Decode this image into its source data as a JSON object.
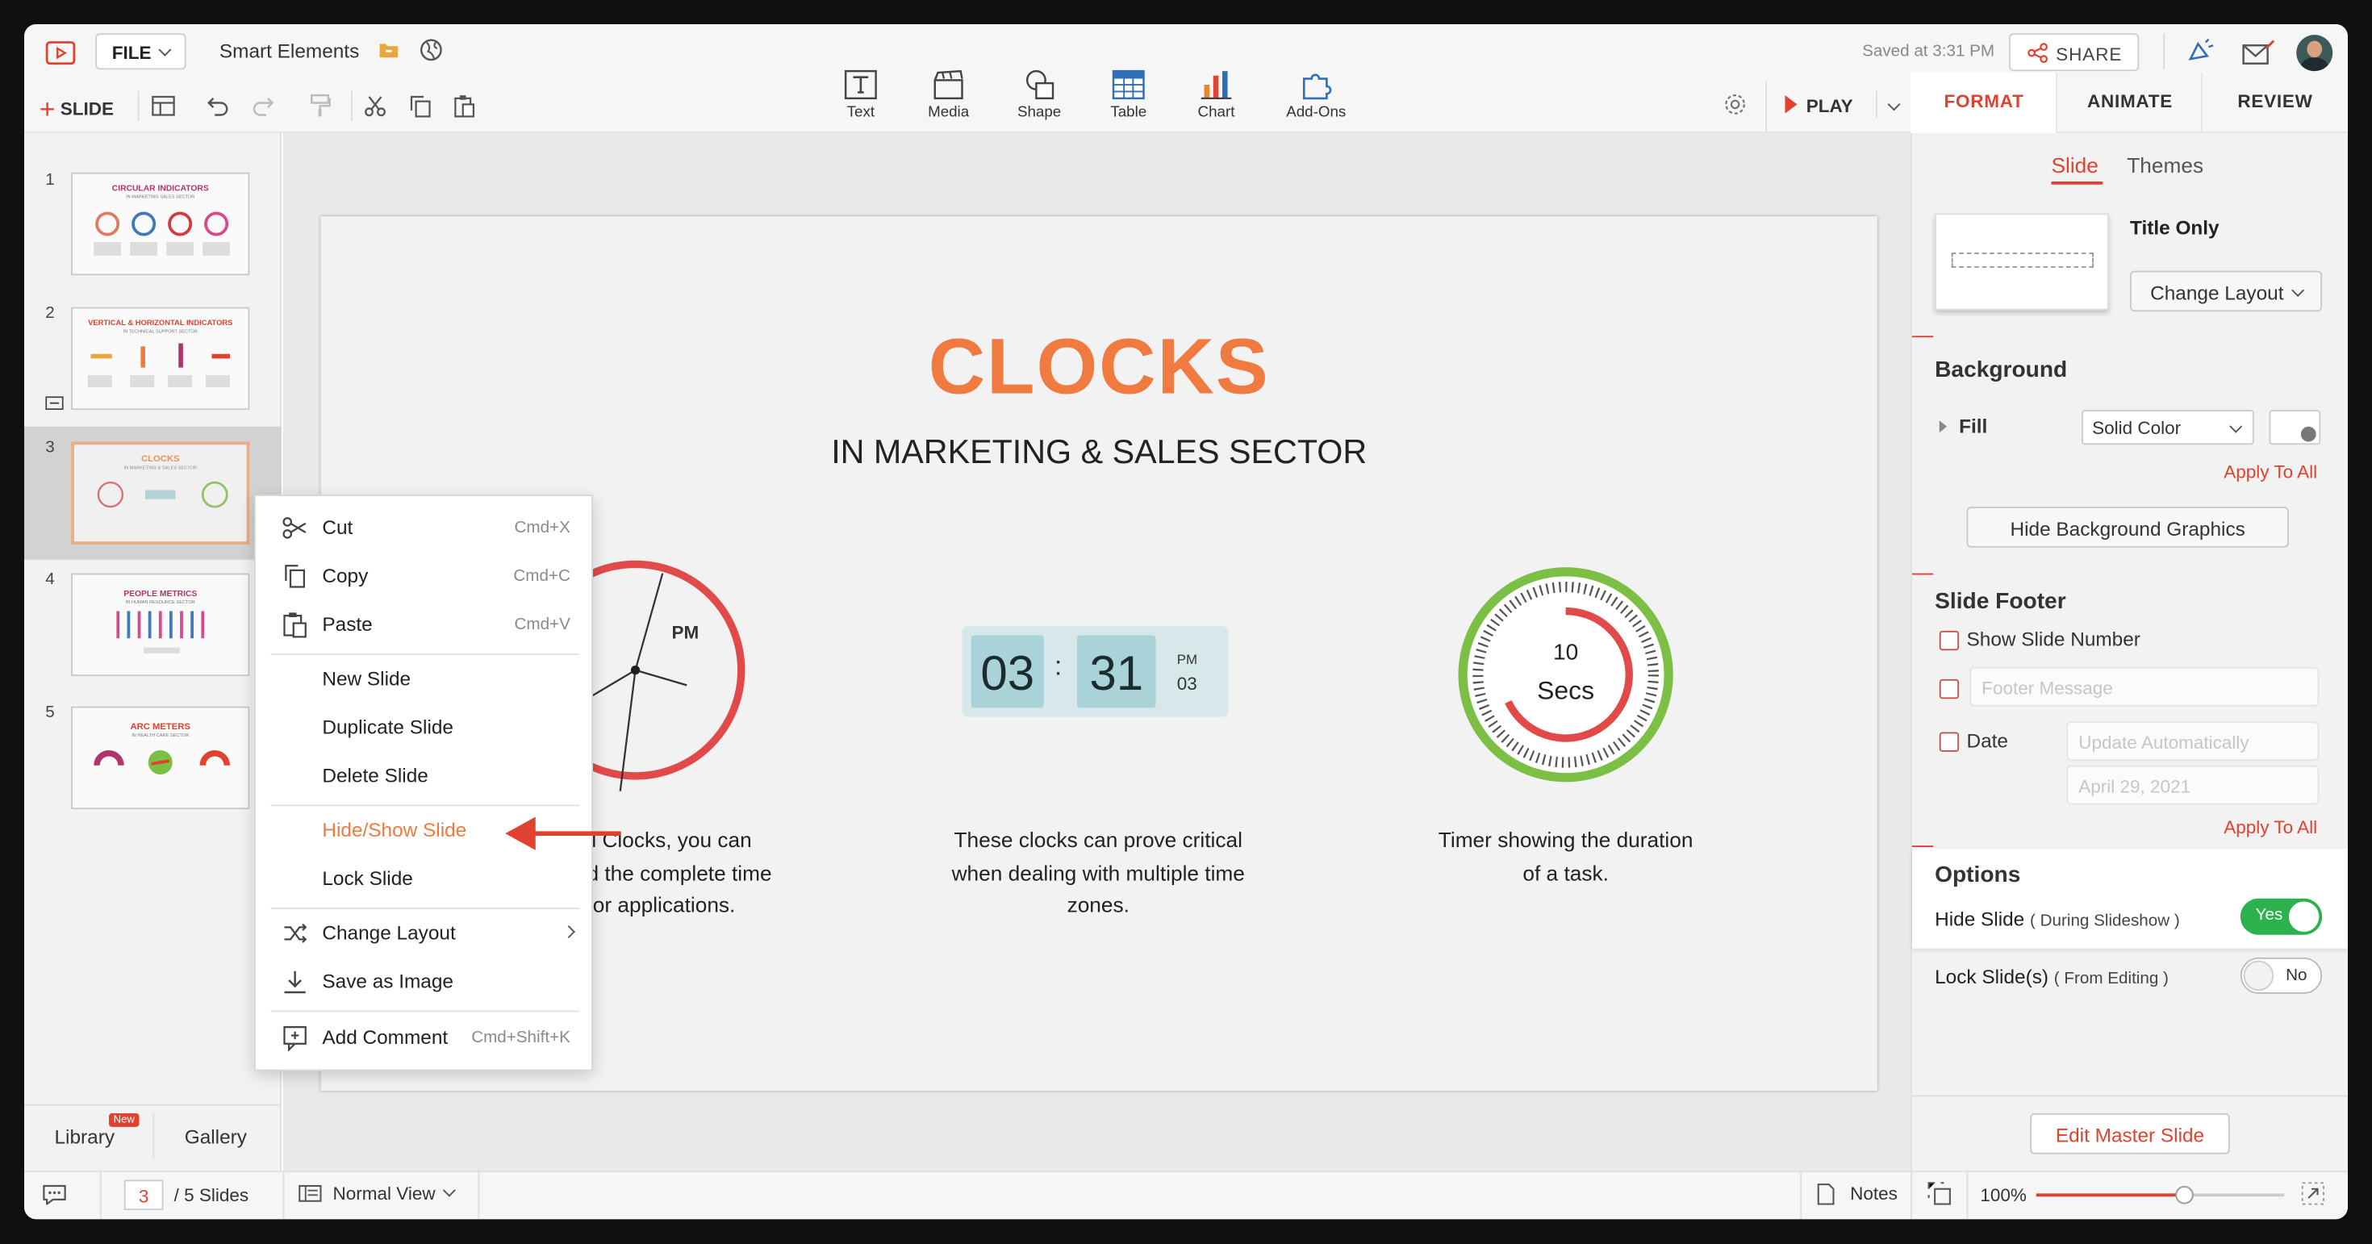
{
  "app": {
    "doc_title": "Smart Elements",
    "file_menu": "FILE",
    "saved_status": "Saved at 3:31 PM",
    "share_label": "SHARE"
  },
  "toolbar": {
    "slide_label": "SLIDE",
    "play_label": "PLAY"
  },
  "insert_tools": [
    "Text",
    "Media",
    "Shape",
    "Table",
    "Chart",
    "Add-Ons"
  ],
  "right_tabs": {
    "format": "FORMAT",
    "animate": "ANIMATE",
    "review": "REVIEW"
  },
  "format_subtabs": {
    "slide": "Slide",
    "themes": "Themes"
  },
  "layout": {
    "name": "Title Only",
    "change_button": "Change Layout"
  },
  "background": {
    "heading": "Background",
    "fill_label": "Fill",
    "fill_value": "Solid Color",
    "apply_all": "Apply To All",
    "hide_graphics_button": "Hide Background Graphics"
  },
  "footer": {
    "heading": "Slide Footer",
    "show_number": "Show Slide Number",
    "footer_placeholder": "Footer Message",
    "date_label": "Date",
    "date_mode": "Update Automatically",
    "date_value": "April 29, 2021",
    "apply_all": "Apply To All"
  },
  "options": {
    "heading": "Options",
    "hide_slide": "Hide Slide",
    "hide_slide_note": "( During Slideshow )",
    "hide_toggle": "Yes",
    "lock_slide": "Lock Slide(s)",
    "lock_slide_note": "( From Editing )",
    "lock_toggle": "No"
  },
  "edit_master": "Edit Master Slide",
  "slides": [
    {
      "num": "1",
      "title": "CIRCULAR INDICATORS",
      "sub": "IN MARKETING SALES SECTOR"
    },
    {
      "num": "2",
      "title": "VERTICAL & HORIZONTAL INDICATORS",
      "sub": "IN TECHNICAL SUPPORT SECTOR"
    },
    {
      "num": "3",
      "title": "CLOCKS",
      "sub": "IN MARKETING & SALES SECTOR"
    },
    {
      "num": "4",
      "title": "PEOPLE METRICS",
      "sub": "IN HUMAN RESOURCE SECTOR"
    },
    {
      "num": "5",
      "title": "ARC METERS",
      "sub": "IN HEALTH CARE SECTOR"
    }
  ],
  "left_bottom": {
    "library": "Library",
    "new_badge": "New",
    "gallery": "Gallery"
  },
  "context_menu": [
    {
      "label": "Cut",
      "shortcut": "Cmd+X"
    },
    {
      "label": "Copy",
      "shortcut": "Cmd+C"
    },
    {
      "label": "Paste",
      "shortcut": "Cmd+V"
    },
    {
      "label": "New Slide",
      "shortcut": ""
    },
    {
      "label": "Duplicate Slide",
      "shortcut": ""
    },
    {
      "label": "Delete Slide",
      "shortcut": ""
    },
    {
      "label": "Hide/Show Slide",
      "shortcut": ""
    },
    {
      "label": "Lock Slide",
      "shortcut": ""
    },
    {
      "label": "Change Layout",
      "shortcut": ""
    },
    {
      "label": "Save as Image",
      "shortcut": ""
    },
    {
      "label": "Add Comment",
      "shortcut": "Cmd+Shift+K"
    }
  ],
  "canvas": {
    "title": "CLOCKS",
    "subtitle": "IN MARKETING & SALES SECTOR",
    "clock_ampm": "PM",
    "digital_hours": "03",
    "digital_colon": ":",
    "digital_minutes": "31",
    "digital_ampm": "PM",
    "digital_seconds": "03",
    "timer_value": "10",
    "timer_unit": "Secs",
    "caption_left": [
      "ll Clocks, you can",
      "d the complete time",
      "for applications."
    ],
    "caption_mid": [
      "These clocks can prove critical",
      "when dealing with multiple time",
      "zones."
    ],
    "caption_right": [
      "Timer showing the duration",
      "of a task."
    ]
  },
  "status": {
    "current_slide": "3",
    "total": "/ 5 Slides",
    "view": "Normal View",
    "notes": "Notes",
    "zoom": "100%",
    "zoom_level": 0.6
  },
  "colors": {
    "accent": "#e0422f",
    "orange": "#f07a3f",
    "toggle_green": "#2bb24c",
    "clock_red": "#e24a4a",
    "timer_green": "#7cbf45"
  }
}
